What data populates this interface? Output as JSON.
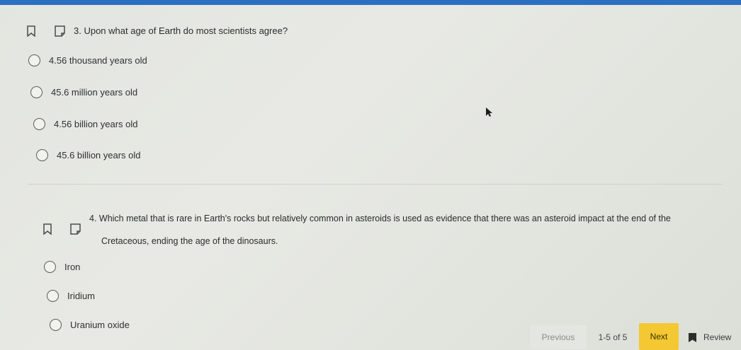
{
  "questions": [
    {
      "text": "3. Upon what age of Earth do most scientists  agree?",
      "options": [
        "4.56 thousand years  old",
        "45.6 million years  old",
        "4.56 billion years  old",
        "45.6 billion years  old"
      ]
    },
    {
      "text_line1": "4. Which metal that is rare in Earth's rocks but relatively common in asteroids is used as evidence that there was an asteroid impact at the end of the",
      "text_line2": "Cretaceous, ending the age of the dinosaurs.",
      "options": [
        "Iron",
        "Iridium",
        "Uranium oxide"
      ]
    }
  ],
  "footer": {
    "previous_label": "Previous",
    "page_count": "1-5 of 5",
    "next_label": "Next",
    "review_label": "Review"
  },
  "colors": {
    "topbar": "#2a6fc1",
    "next_button": "#f4c832"
  },
  "icons": [
    "bookmark-icon",
    "flag-outline-icon",
    "radio-icon",
    "review-flag-icon",
    "cursor-icon"
  ]
}
